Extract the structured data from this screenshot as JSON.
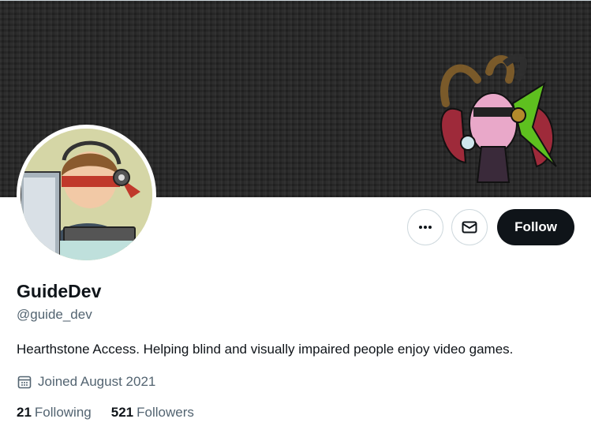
{
  "profile": {
    "display_name": "GuideDev",
    "handle": "@guide_dev",
    "bio": "Hearthstone Access. Helping blind and visually impaired people enjoy video games.",
    "joined": "Joined August 2021"
  },
  "actions": {
    "more_icon": "more-horizontal-icon",
    "message_icon": "envelope-icon",
    "follow_label": "Follow"
  },
  "stats": {
    "following_count": "21",
    "following_label": "Following",
    "followers_count": "521",
    "followers_label": "Followers"
  },
  "colors": {
    "primary_text": "#0f1419",
    "secondary_text": "#536471",
    "border": "#cfd9de",
    "follow_button_bg": "#0f1419",
    "banner_bg": "#262626"
  }
}
